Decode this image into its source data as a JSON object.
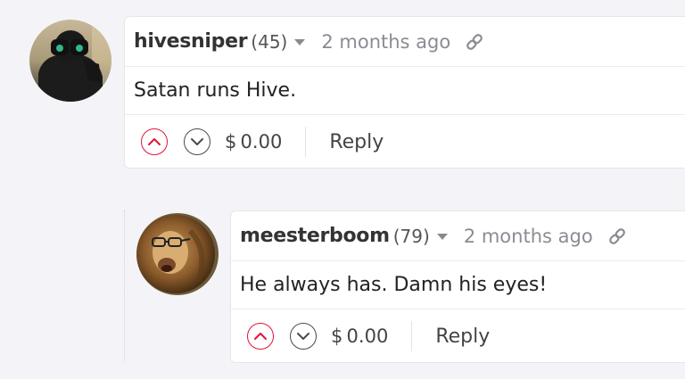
{
  "comments": [
    {
      "author": "hivesniper",
      "reputation": "(45)",
      "time": "2 months ago",
      "body": "Satan runs Hive.",
      "payout": "$ 0.00",
      "reply_label": "Reply",
      "avatar_icon": "binoculars-silhouette-avatar"
    },
    {
      "author": "meesterboom",
      "reputation": "(79)",
      "time": "2 months ago",
      "body": "He always has. Damn his eyes!",
      "payout": "$ 0.00",
      "reply_label": "Reply",
      "avatar_icon": "lion-with-glasses-avatar"
    }
  ],
  "colors": {
    "upvote": "#e31337",
    "downvote": "#4a4a4a",
    "time": "#8b8b93",
    "background": "#f4f4f8"
  }
}
